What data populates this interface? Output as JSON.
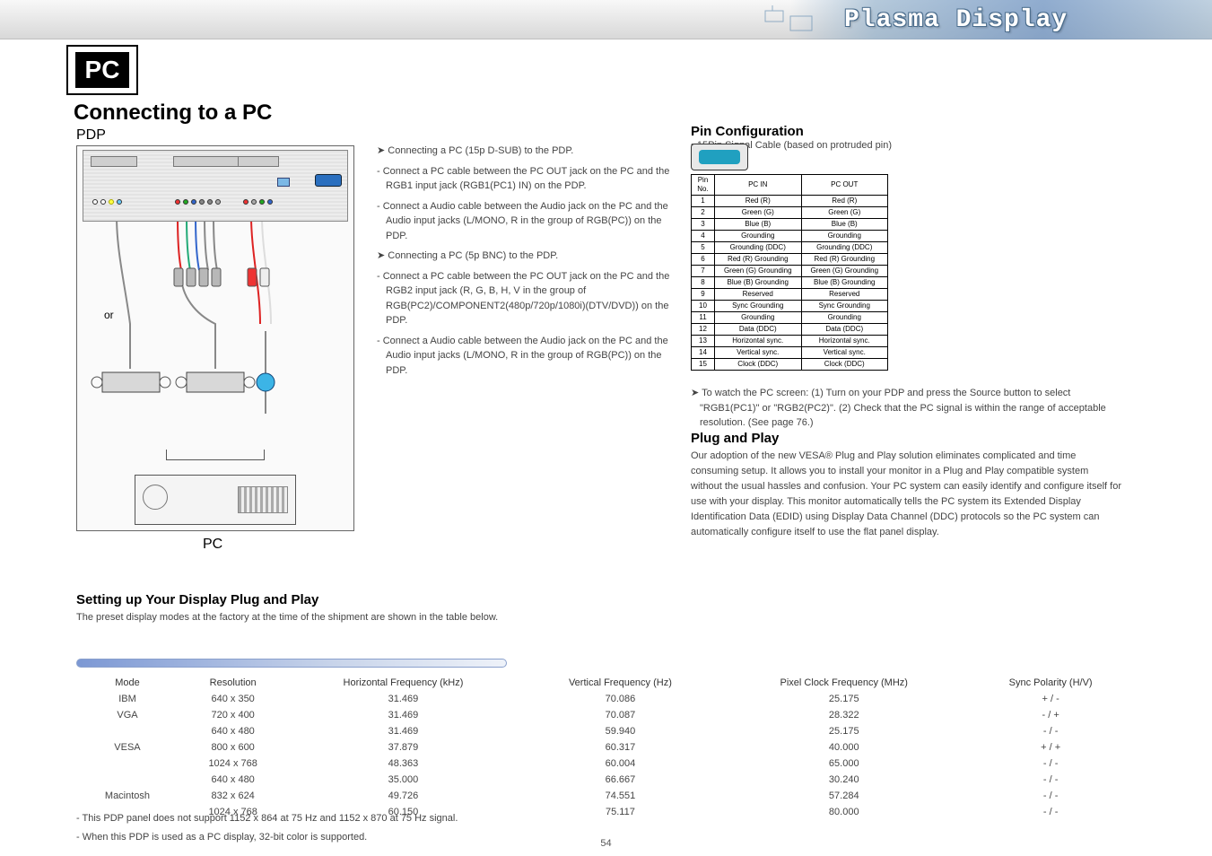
{
  "header": {
    "title": "Plasma Display"
  },
  "badge": "PC",
  "section_title": "Connecting to a PC",
  "pdp_label": "PDP",
  "or_label": "or",
  "pc_label_under": "PC",
  "left_notes": [
    "➤ Connecting a PC (15p D-SUB) to the PDP.",
    "- Connect a PC cable between the PC OUT jack on the PC and the RGB1 input jack (RGB1(PC1) IN) on the PDP.",
    "- Connect a Audio cable between the Audio jack on the PC and the Audio input jacks (L/MONO, R in the group of RGB(PC)) on the PDP.",
    "➤ Connecting a PC (5p BNC) to the PDP.",
    "- Connect a PC cable between the PC OUT jack on the PC and the RGB2 input jack (R, G, B, H, V in the group of RGB(PC2)/COMPONENT2(480p/720p/1080i)(DTV/DVD)) on the PDP.",
    "- Connect a Audio cable between the Audio jack on the PC and the Audio input jacks (L/MONO, R in the group of RGB(PC)) on the PDP."
  ],
  "pin_title": "Pin Configuration",
  "pin_sub": "• 15Pin Signal Cable (based on protruded pin)",
  "pin_headers": [
    "Pin No.",
    "PC IN",
    "PC OUT"
  ],
  "pins": [
    {
      "n": "1",
      "in": "Red (R)",
      "out": "Red (R)"
    },
    {
      "n": "2",
      "in": "Green (G)",
      "out": "Green (G)"
    },
    {
      "n": "3",
      "in": "Blue (B)",
      "out": "Blue (B)"
    },
    {
      "n": "4",
      "in": "Grounding",
      "out": "Grounding"
    },
    {
      "n": "5",
      "in": "Grounding (DDC)",
      "out": "Grounding (DDC)"
    },
    {
      "n": "6",
      "in": "Red (R) Grounding",
      "out": "Red (R) Grounding"
    },
    {
      "n": "7",
      "in": "Green (G) Grounding",
      "out": "Green (G) Grounding"
    },
    {
      "n": "8",
      "in": "Blue (B) Grounding",
      "out": "Blue (B) Grounding"
    },
    {
      "n": "9",
      "in": "Reserved",
      "out": "Reserved"
    },
    {
      "n": "10",
      "in": "Sync Grounding",
      "out": "Sync Grounding"
    },
    {
      "n": "11",
      "in": "Grounding",
      "out": "Grounding"
    },
    {
      "n": "12",
      "in": "Data (DDC)",
      "out": "Data (DDC)"
    },
    {
      "n": "13",
      "in": "Horizontal sync.",
      "out": "Horizontal sync."
    },
    {
      "n": "14",
      "in": "Vertical sync.",
      "out": "Vertical sync."
    },
    {
      "n": "15",
      "in": "Clock (DDC)",
      "out": "Clock (DDC)"
    }
  ],
  "right_notes": [
    "➤ To watch the PC screen: (1) Turn on your PDP and press the Source button to select \"RGB1(PC1)\" or \"RGB2(PC2)\". (2) Check that the PC signal is within the range of acceptable resolution. (See page 76.)"
  ],
  "plugplay_title": "Plug and Play",
  "plugplay_body": "Our adoption of the new VESA® Plug and Play solution eliminates complicated and time consuming setup. It allows you to install your monitor in a Plug and Play compatible system without the usual hassles and confusion. Your PC system can easily identify and configure itself for use with your display. This monitor automatically tells the PC system its Extended Display Identification Data (EDID) using Display Data Channel (DDC) protocols so the PC system can automatically configure itself to use the flat panel display.",
  "modes_title": "Setting up Your Display Plug and Play",
  "modes_intro": "The preset display modes at the factory at the time of the shipment are shown in the table below.",
  "modes_headers": [
    "Mode",
    "Resolution",
    "Horizontal Frequency (kHz)",
    "Vertical Frequency (Hz)",
    "Pixel Clock Frequency (MHz)",
    "Sync Polarity (H/V)"
  ],
  "modes": [
    {
      "m": "IBM",
      "r": "640 x 350",
      "h": "31.469",
      "v": "70.086",
      "p": "25.175",
      "s": "+ / -"
    },
    {
      "m": "VGA",
      "r": "720 x 400",
      "h": "31.469",
      "v": "70.087",
      "p": "28.322",
      "s": "- / +"
    },
    {
      "m": "",
      "r": "640 x 480",
      "h": "31.469",
      "v": "59.940",
      "p": "25.175",
      "s": "- / -"
    },
    {
      "m": "VESA",
      "r": "800 x 600",
      "h": "37.879",
      "v": "60.317",
      "p": "40.000",
      "s": "+ / +"
    },
    {
      "m": "",
      "r": "1024 x 768",
      "h": "48.363",
      "v": "60.004",
      "p": "65.000",
      "s": "- / -"
    },
    {
      "m": "",
      "r": "640 x 480",
      "h": "35.000",
      "v": "66.667",
      "p": "30.240",
      "s": "- / -"
    },
    {
      "m": "Macintosh",
      "r": "832 x 624",
      "h": "49.726",
      "v": "74.551",
      "p": "57.284",
      "s": "- / -"
    },
    {
      "m": "",
      "r": "1024 x 768",
      "h": "60.150",
      "v": "75.117",
      "p": "80.000",
      "s": "- / -"
    }
  ],
  "footnotes": [
    "- This PDP panel does not support 1152 x 864 at 75 Hz and 1152 x 870 at 75 Hz signal.",
    "- When this PDP is used as a PC display, 32-bit color is supported."
  ],
  "page_number": "54"
}
